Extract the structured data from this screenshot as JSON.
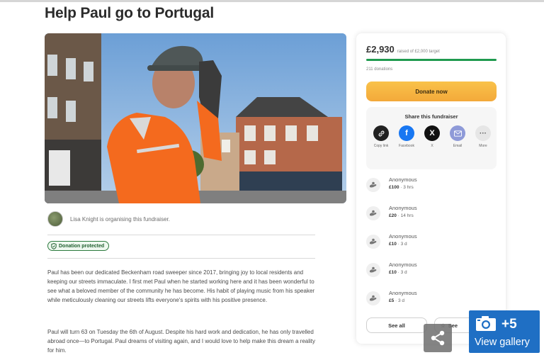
{
  "page": {
    "title": "Help Paul go to Portugal"
  },
  "organiser": {
    "text": "Lisa Knight is organising this fundraiser."
  },
  "badge": {
    "label": "Donation protected"
  },
  "story": {
    "paragraph1": "Paul has been our dedicated Beckenham road sweeper since 2017, bringing joy to local residents and keeping our streets immaculate. I first met Paul when he started working here and it has been wonderful to see what a beloved member of the community he has become. His habit of playing music from his speaker while meticulously cleaning our streets lifts everyone's spirits with his positive presence.",
    "paragraph2": "Paul will turn 63 on Tuesday the 6th of August. Despite his hard work and dedication, he has only travelled abroad once—to Portugal. Paul dreams of visiting again, and I would love to help make this dream a reality for him."
  },
  "card": {
    "raised": "£2,930",
    "target": "raised of £2,000 target",
    "progress_fraction": 1.0,
    "donations_count": "211 donations",
    "donate_label": "Donate now",
    "share_title": "Share this fundraiser",
    "share_options": [
      {
        "label": "Copy link",
        "icon": "link-icon",
        "color": "#222222"
      },
      {
        "label": "Facebook",
        "icon": "facebook-icon",
        "color": "#1877f2"
      },
      {
        "label": "X",
        "icon": "x-icon",
        "color": "#111111"
      },
      {
        "label": "Email",
        "icon": "email-icon",
        "color": "#8e9ad8"
      },
      {
        "label": "More",
        "icon": "more-icon",
        "color": "#e6e6e6"
      }
    ],
    "donors": [
      {
        "name": "Anonymous",
        "amount": "£100",
        "time": "3 hrs"
      },
      {
        "name": "Anonymous",
        "amount": "£20",
        "time": "14 hrs"
      },
      {
        "name": "Anonymous",
        "amount": "£10",
        "time": "3 d"
      },
      {
        "name": "Anonymous",
        "amount": "£10",
        "time": "3 d"
      },
      {
        "name": "Anonymous",
        "amount": "£5",
        "time": "3 d"
      }
    ],
    "see_all_label": "See all",
    "see_top_label": "See"
  },
  "gallery": {
    "count": "+5",
    "label": "View gallery"
  }
}
